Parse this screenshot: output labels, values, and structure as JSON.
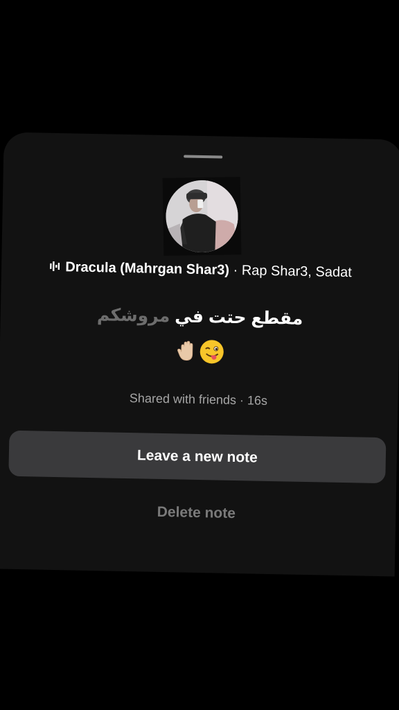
{
  "note_sheet": {
    "grabber_icon": "drag-handle",
    "avatar_icon": "profile-photo",
    "song": {
      "icon": "audio-bars-icon",
      "title": "Dracula (Mahrgan Shar3)",
      "separator": "·",
      "artist": "Rap Shar3, Sadat"
    },
    "note": {
      "text_primary": "مقطع حتت في",
      "text_secondary": "مروشكم",
      "emojis": [
        "raised-hand",
        "winking-tongue-face"
      ]
    },
    "shared_status": "Shared with friends · 16s",
    "leave_button_label": "Leave a new note",
    "delete_label": "Delete note"
  },
  "colors": {
    "background": "#000000",
    "sheet": "#121212",
    "button": "#3a3a3c",
    "secondary_text": "#a6a6a6",
    "muted_text": "#7a7a7a"
  }
}
